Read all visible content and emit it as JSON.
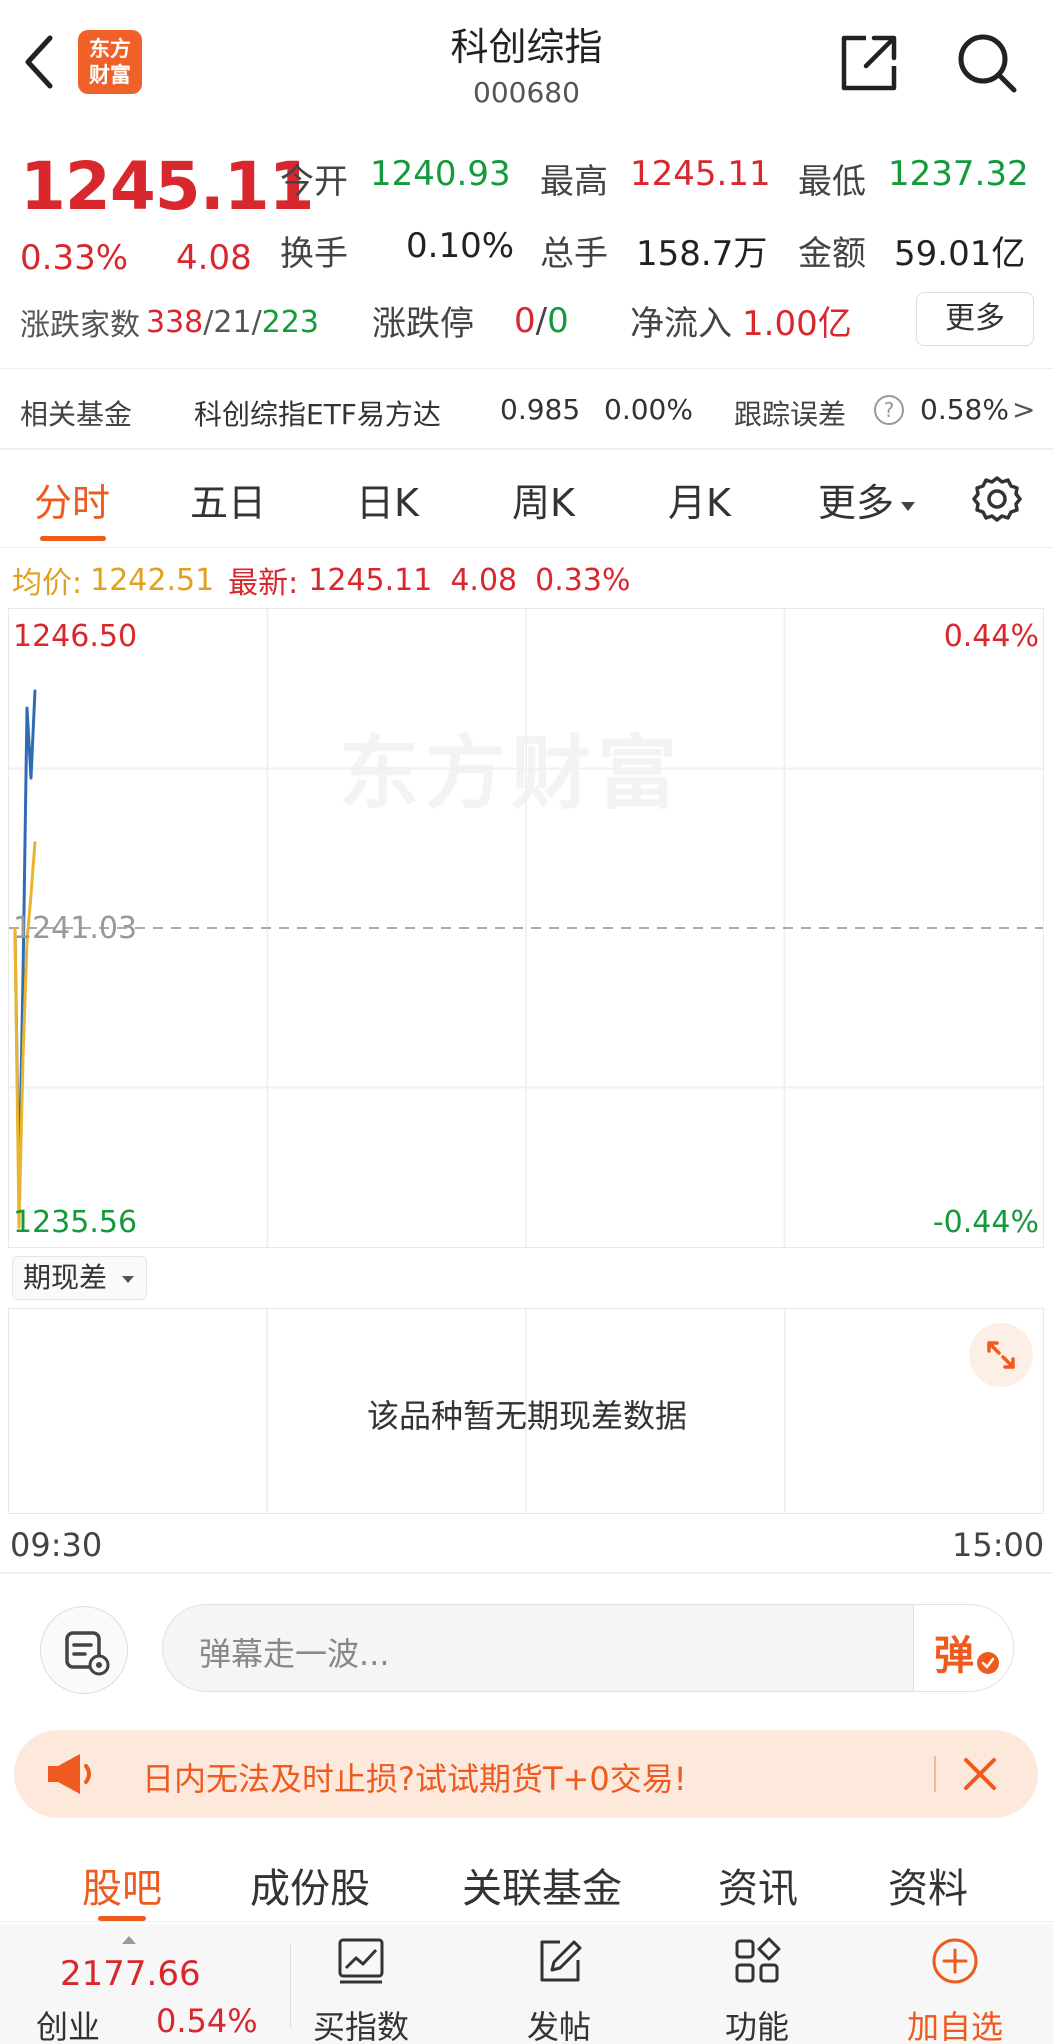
{
  "header": {
    "logo_text_1": "东方",
    "logo_text_2": "财富",
    "title": "科创综指",
    "code": "000680"
  },
  "quote": {
    "price": "1245.11",
    "change_pct": "0.33%",
    "change": "4.08",
    "open_label": "今开",
    "open": "1240.93",
    "high_label": "最高",
    "high": "1245.11",
    "low_label": "最低",
    "low": "1237.32",
    "turnover_label": "换手",
    "turnover": "0.10%",
    "volume_label": "总手",
    "volume": "158.7万",
    "amount_label": "金额",
    "amount": "59.01亿",
    "adv_dec_label": "涨跌家数",
    "adv": "338",
    "flat": "21",
    "dec": "223",
    "limit_label": "涨跌停",
    "limit_up": "0",
    "limit_down": "0",
    "net_inflow_label": "净流入",
    "net_inflow": "1.00亿",
    "more_label": "更多",
    "slash": "/"
  },
  "fund": {
    "label": "相关基金",
    "name": "科创综指ETF易方达",
    "nav": "0.985",
    "pct": "0.00%",
    "tracking_label": "跟踪误差",
    "tracking_help": "?",
    "tracking_value": "0.58%",
    "arrow": ">"
  },
  "chart_tabs": [
    {
      "label": "分时"
    },
    {
      "label": "五日"
    },
    {
      "label": "日K"
    },
    {
      "label": "周K"
    },
    {
      "label": "月K"
    },
    {
      "label": "更多"
    }
  ],
  "info_line": {
    "avg_label": "均价:",
    "avg_value": "1242.51",
    "latest_label": "最新:",
    "latest_value": "1245.11",
    "latest_change": "4.08",
    "latest_pct": "0.33%"
  },
  "chart": {
    "watermark": "东方财富",
    "y_max": "1246.50",
    "y_mid": "1241.03",
    "y_min": "1235.56",
    "pct_max": "0.44%",
    "pct_min": "-0.44%",
    "x_start": "09:30",
    "x_end": "15:00"
  },
  "sub_chart": {
    "select_label": "期现差",
    "empty_text": "该品种暂无期现差数据"
  },
  "danmu": {
    "placeholder": "弹幕走一波...",
    "send_label": "弹"
  },
  "promo": {
    "text": "日内无法及时止损?试试期货T+0交易!"
  },
  "bottom_tabs": [
    {
      "label": "股吧"
    },
    {
      "label": "成份股"
    },
    {
      "label": "关联基金"
    },
    {
      "label": "资讯"
    },
    {
      "label": "资料"
    }
  ],
  "footer": {
    "index_value": "2177.66",
    "index_name": "创业",
    "index_pct": "0.54%",
    "items": [
      {
        "label": "买指数",
        "icon": "chart-trend-icon"
      },
      {
        "label": "发帖",
        "icon": "edit-icon"
      },
      {
        "label": "功能",
        "icon": "grid-icon"
      },
      {
        "label": "加自选",
        "icon": "plus-circle-icon"
      }
    ]
  },
  "chart_data": {
    "type": "line",
    "ylim": [
      1235.56,
      1246.5
    ],
    "prev_close": 1241.03,
    "series": [
      {
        "values": [
          1241.0,
          1236.5,
          1240.2,
          1244.8,
          1243.6,
          1245.11
        ]
      },
      {
        "values": [
          1241.03,
          1235.9,
          1238.8,
          1240.8,
          1241.6,
          1242.51
        ]
      }
    ],
    "colors": {
      "price": "#2f6cb3",
      "avg": "#e8b530",
      "up": "#d9272e",
      "down": "#149a3a"
    }
  }
}
